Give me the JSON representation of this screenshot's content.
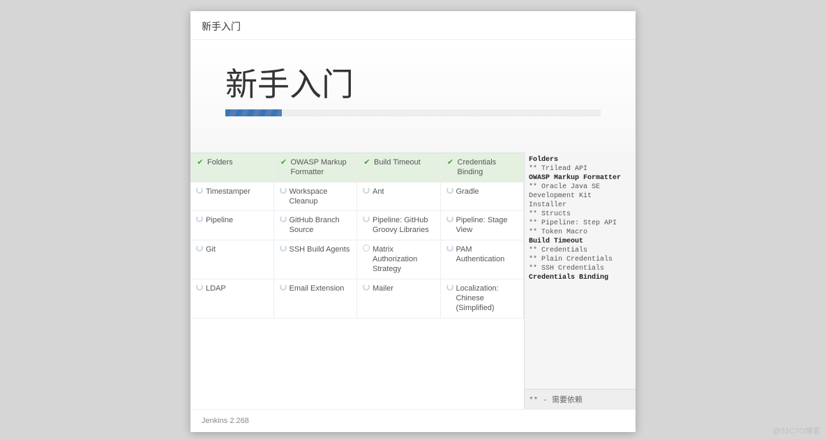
{
  "header": {
    "title": "新手入门"
  },
  "hero": {
    "title": "新手入门",
    "progress_pct": 15
  },
  "plugins": [
    {
      "name": "Folders",
      "state": "done"
    },
    {
      "name": "OWASP Markup Formatter",
      "state": "done"
    },
    {
      "name": "Build Timeout",
      "state": "done"
    },
    {
      "name": "Credentials Binding",
      "state": "done"
    },
    {
      "name": "Timestamper",
      "state": "spinner"
    },
    {
      "name": "Workspace Cleanup",
      "state": "spinner"
    },
    {
      "name": "Ant",
      "state": "spinner"
    },
    {
      "name": "Gradle",
      "state": "spinner"
    },
    {
      "name": "Pipeline",
      "state": "spinner"
    },
    {
      "name": "GitHub Branch Source",
      "state": "spinner"
    },
    {
      "name": "Pipeline: GitHub Groovy Libraries",
      "state": "spinner"
    },
    {
      "name": "Pipeline: Stage View",
      "state": "spinner"
    },
    {
      "name": "Git",
      "state": "spinner"
    },
    {
      "name": "SSH Build Agents",
      "state": "spinner"
    },
    {
      "name": "Matrix Authorization Strategy",
      "state": "pending"
    },
    {
      "name": "PAM Authentication",
      "state": "spinner"
    },
    {
      "name": "LDAP",
      "state": "spinner"
    },
    {
      "name": "Email Extension",
      "state": "spinner"
    },
    {
      "name": "Mailer",
      "state": "spinner"
    },
    {
      "name": "Localization: Chinese (Simplified)",
      "state": "spinner"
    }
  ],
  "log": {
    "lines": [
      {
        "text": "Folders",
        "bold": true
      },
      {
        "text": "** Trilead API",
        "bold": false
      },
      {
        "text": "OWASP Markup Formatter",
        "bold": true
      },
      {
        "text": "** Oracle Java SE Development Kit Installer",
        "bold": false
      },
      {
        "text": "** Structs",
        "bold": false
      },
      {
        "text": "** Pipeline: Step API",
        "bold": false
      },
      {
        "text": "** Token Macro",
        "bold": false
      },
      {
        "text": "Build Timeout",
        "bold": true
      },
      {
        "text": "** Credentials",
        "bold": false
      },
      {
        "text": "** Plain Credentials",
        "bold": false
      },
      {
        "text": "** SSH Credentials",
        "bold": false
      },
      {
        "text": "Credentials Binding",
        "bold": true
      }
    ],
    "footer": "** - 需要依赖"
  },
  "footer": {
    "version": "Jenkins 2.268"
  },
  "watermark": "@51CTO博客"
}
